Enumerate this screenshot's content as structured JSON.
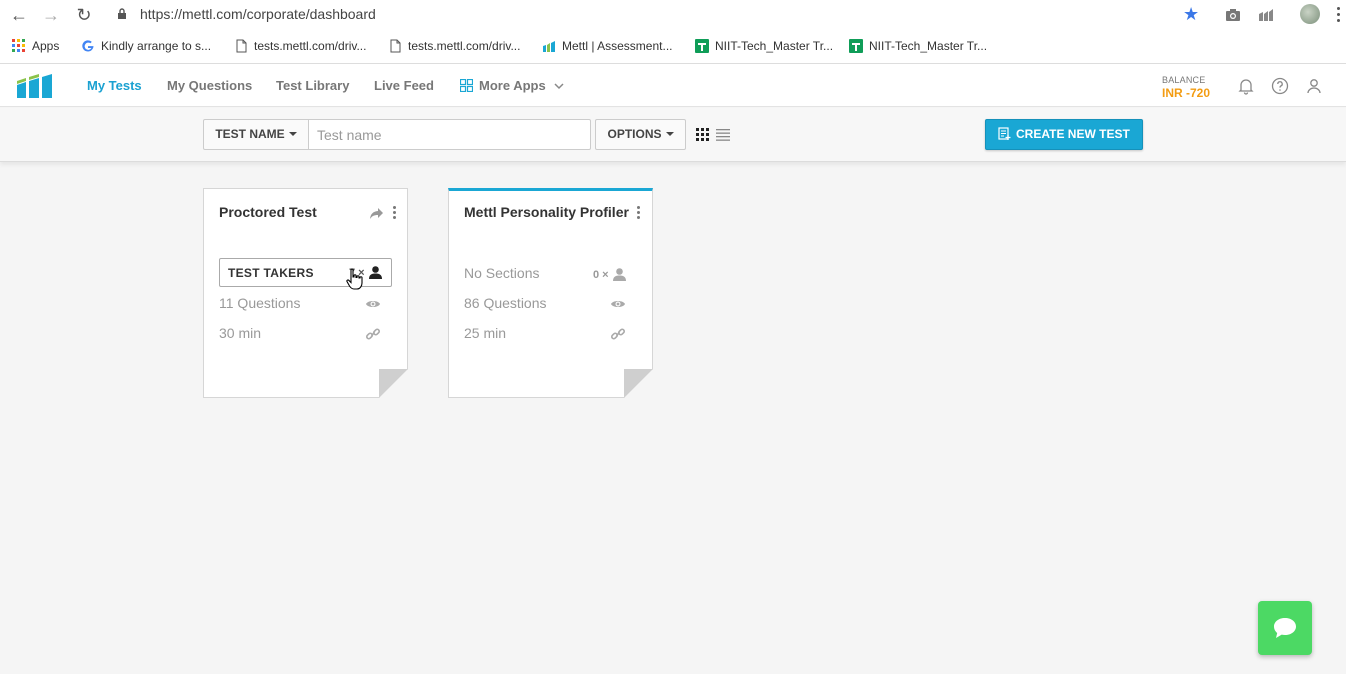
{
  "browser": {
    "url": "https://mettl.com/corporate/dashboard",
    "bookmarks": [
      {
        "label": "Apps",
        "icon": "apps-grid-icon"
      },
      {
        "label": "Kindly arrange to s...",
        "icon": "google-icon"
      },
      {
        "label": "tests.mettl.com/driv...",
        "icon": "page-icon"
      },
      {
        "label": "tests.mettl.com/driv...",
        "icon": "page-icon"
      },
      {
        "label": "Mettl | Assessment...",
        "icon": "mettl-icon"
      },
      {
        "label": "NIIT-Tech_Master Tr...",
        "icon": "sheets-icon"
      },
      {
        "label": "NIIT-Tech_Master Tr...",
        "icon": "sheets-icon"
      }
    ]
  },
  "header": {
    "nav": [
      "My Tests",
      "My Questions",
      "Test Library",
      "Live Feed",
      "More Apps"
    ],
    "active_nav": "My Tests",
    "balance_label": "BALANCE",
    "balance_value": "INR -720"
  },
  "toolbar": {
    "filter_label": "TEST NAME",
    "search_placeholder": "Test name",
    "options_label": "OPTIONS",
    "create_label": "CREATE NEW TEST"
  },
  "cards": [
    {
      "title": "Proctored Test",
      "takers_label": "TEST TAKERS",
      "takers_count": "7 ×",
      "questions": "11 Questions",
      "duration": "30 min"
    },
    {
      "title": "Mettl Personality Profiler",
      "sections": "No Sections",
      "sections_count": "0 ×",
      "questions": "86 Questions",
      "duration": "25 min"
    }
  ],
  "colors": {
    "accent": "#1aa7d4",
    "balance": "#f39c12",
    "chat": "#4cd964"
  }
}
